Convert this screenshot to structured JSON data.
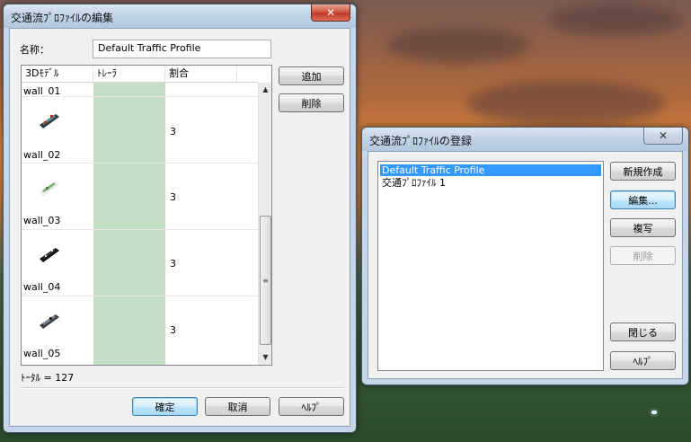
{
  "edit_dialog": {
    "title": "交通流ﾌﾟﾛﾌｧｲﾙの編集",
    "close_symbol": "✕",
    "name_label": "名称：",
    "name_value": "Default Traffic Profile",
    "columns": [
      "3Dﾓﾃﾞﾙ",
      "ﾄﾚｰﾗ",
      "割合"
    ],
    "rows": [
      {
        "name": "wall_01",
        "ratio": ""
      },
      {
        "name": "wall_02",
        "ratio": "3"
      },
      {
        "name": "wall_03",
        "ratio": "3"
      },
      {
        "name": "wall_04",
        "ratio": "3"
      },
      {
        "name": "wall_05",
        "ratio": "3"
      }
    ],
    "add_label": "追加",
    "delete_label": "削除",
    "total_text": "ﾄｰﾀﾙ = 127",
    "ok_label": "確定",
    "cancel_label": "取消",
    "help_label": "ﾍﾙﾌﾟ",
    "colors": {
      "trailer_cell": "#c4dfc6"
    }
  },
  "register_dialog": {
    "title": "交通流ﾌﾟﾛﾌｧｲﾙの登録",
    "close_symbol": "✕",
    "profiles": [
      "Default Traffic Profile",
      "交通ﾌﾟﾛﾌｧｲﾙ 1"
    ],
    "selected_index": 0,
    "new_label": "新規作成",
    "edit_label": "編集...",
    "copy_label": "複写",
    "delete_label": "削除",
    "close_label": "閉じる",
    "help_label": "ﾍﾙﾌﾟ"
  },
  "icons": {
    "close": "close-icon",
    "scroll_up": "chevron-up-icon",
    "scroll_down": "chevron-down-icon",
    "model_thumb": "wall-model-thumbnail"
  }
}
